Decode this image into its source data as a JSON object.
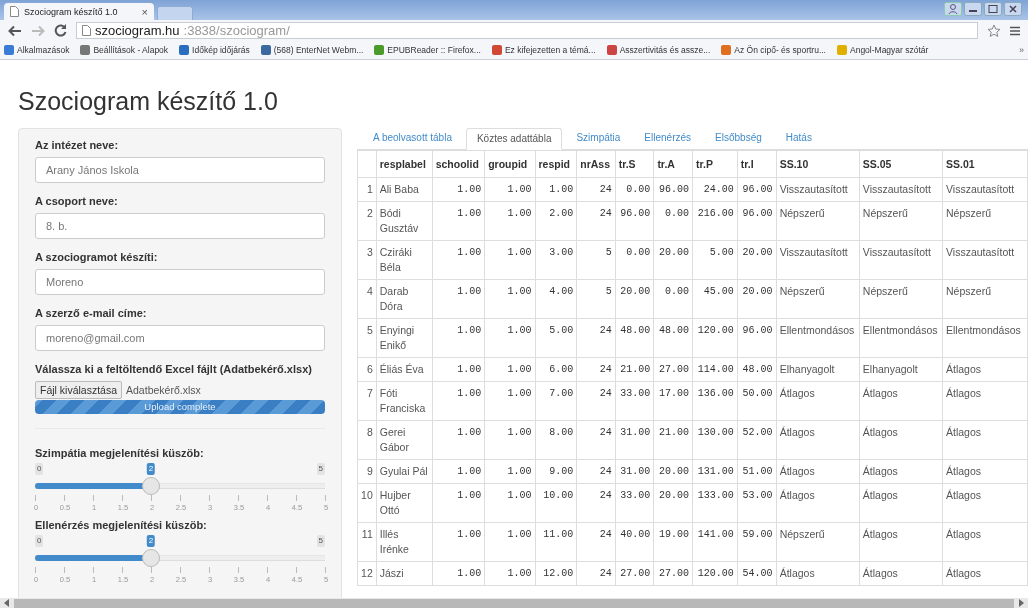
{
  "browser": {
    "tab_title": "Szociogram készítő 1.0",
    "close": "×",
    "address_host": "szociogram.hu",
    "address_rest": ":3838/szociogram/",
    "bookmarks": [
      "Alkalmazások",
      "Beállítások - Alapok",
      "Időkép időjárás",
      "(568) EnterNet Webm...",
      "EPUBReader :: Firefox...",
      "Ez kifejezetten a témá...",
      "Asszertivitás és assze...",
      "Az Ön cipő- és sportru...",
      "Angol-Magyar szótár"
    ],
    "more": "»"
  },
  "page_title": "Szociogram készítő 1.0",
  "sidebar": {
    "fields": [
      {
        "label": "Az intézet neve:",
        "value": "Arany János Iskola"
      },
      {
        "label": "A csoport neve:",
        "value": "8. b."
      },
      {
        "label": "A szociogramot készíti:",
        "value": "Moreno"
      },
      {
        "label": "A szerző e-mail címe:",
        "value": "moreno@gmail.com"
      }
    ],
    "upload": {
      "label": "Válassza ki a feltöltendő Excel fájlt (Adatbekérő.xlsx)",
      "button": "Fájl kiválasztása",
      "file": "Adatbekérő.xlsx",
      "status": "Upload complete",
      "level": 1
    },
    "sliders": [
      {
        "label": "Szimpátia megjelenítési küszöb:",
        "min": "0",
        "max": "5",
        "value": "2",
        "level": 0.4,
        "ticks": [
          "0",
          "0.5",
          "1",
          "1.5",
          "2",
          "2.5",
          "3",
          "3.5",
          "4",
          "4.5",
          "5"
        ]
      },
      {
        "label": "Ellenérzés megjelenítési küszöb:",
        "min": "0",
        "max": "5",
        "value": "2",
        "level": 0.4,
        "ticks": [
          "0",
          "0.5",
          "1",
          "1.5",
          "2",
          "2.5",
          "3",
          "3.5",
          "4",
          "4.5",
          "5"
        ]
      }
    ]
  },
  "tabs": [
    {
      "label": "A beolvasott tábla",
      "selected": false
    },
    {
      "label": "Köztes adattábla",
      "selected": true
    },
    {
      "label": "Szimpátia",
      "selected": false
    },
    {
      "label": "Ellenérzés",
      "selected": false
    },
    {
      "label": "Elsőbbség",
      "selected": false
    },
    {
      "label": "Hatás",
      "selected": false
    }
  ],
  "table": {
    "columns": [
      "resplabel",
      "schoolid",
      "groupid",
      "respid",
      "nrAss",
      "tr.S",
      "tr.A",
      "tr.P",
      "tr.I",
      "SS.10",
      "SS.05",
      "SS.01"
    ],
    "rows": [
      {
        "index": "1",
        "cells": [
          "Ali Baba",
          "1.00",
          "1.00",
          "1.00",
          "24",
          "0.00",
          "96.00",
          "24.00",
          "96.00",
          "Visszautasított",
          "Visszautasított",
          "Visszautasított"
        ]
      },
      {
        "index": "2",
        "cells": [
          "Bódi Gusztáv",
          "1.00",
          "1.00",
          "2.00",
          "24",
          "96.00",
          "0.00",
          "216.00",
          "96.00",
          "Népszerű",
          "Népszerű",
          "Népszerű"
        ]
      },
      {
        "index": "3",
        "cells": [
          "Cziráki Béla",
          "1.00",
          "1.00",
          "3.00",
          "5",
          "0.00",
          "20.00",
          "5.00",
          "20.00",
          "Visszautasított",
          "Visszautasított",
          "Visszautasított"
        ]
      },
      {
        "index": "4",
        "cells": [
          "Darab Dóra",
          "1.00",
          "1.00",
          "4.00",
          "5",
          "20.00",
          "0.00",
          "45.00",
          "20.00",
          "Népszerű",
          "Népszerű",
          "Népszerű"
        ]
      },
      {
        "index": "5",
        "cells": [
          "Enyingi Enikő",
          "1.00",
          "1.00",
          "5.00",
          "24",
          "48.00",
          "48.00",
          "120.00",
          "96.00",
          "Ellentmondásos",
          "Ellentmondásos",
          "Ellentmondásos"
        ]
      },
      {
        "index": "6",
        "cells": [
          "Éliás Éva",
          "1.00",
          "1.00",
          "6.00",
          "24",
          "21.00",
          "27.00",
          "114.00",
          "48.00",
          "Elhanyagolt",
          "Elhanyagolt",
          "Átlagos"
        ]
      },
      {
        "index": "7",
        "cells": [
          "Fóti Franciska",
          "1.00",
          "1.00",
          "7.00",
          "24",
          "33.00",
          "17.00",
          "136.00",
          "50.00",
          "Átlagos",
          "Átlagos",
          "Átlagos"
        ]
      },
      {
        "index": "8",
        "cells": [
          "Gerei Gábor",
          "1.00",
          "1.00",
          "8.00",
          "24",
          "31.00",
          "21.00",
          "130.00",
          "52.00",
          "Átlagos",
          "Átlagos",
          "Átlagos"
        ]
      },
      {
        "index": "9",
        "cells": [
          "Gyulai Pál",
          "1.00",
          "1.00",
          "9.00",
          "24",
          "31.00",
          "20.00",
          "131.00",
          "51.00",
          "Átlagos",
          "Átlagos",
          "Átlagos"
        ]
      },
      {
        "index": "10",
        "cells": [
          "Hujber Ottó",
          "1.00",
          "1.00",
          "10.00",
          "24",
          "33.00",
          "20.00",
          "133.00",
          "53.00",
          "Átlagos",
          "Átlagos",
          "Átlagos"
        ]
      },
      {
        "index": "11",
        "cells": [
          "Illés Irénke",
          "1.00",
          "1.00",
          "11.00",
          "24",
          "40.00",
          "19.00",
          "141.00",
          "59.00",
          "Népszerű",
          "Átlagos",
          "Átlagos"
        ]
      },
      {
        "index": "12",
        "cells": [
          "Jászi",
          "1.00",
          "1.00",
          "12.00",
          "24",
          "27.00",
          "27.00",
          "120.00",
          "54.00",
          "Átlagos",
          "Átlagos",
          "Átlagos"
        ]
      }
    ]
  }
}
